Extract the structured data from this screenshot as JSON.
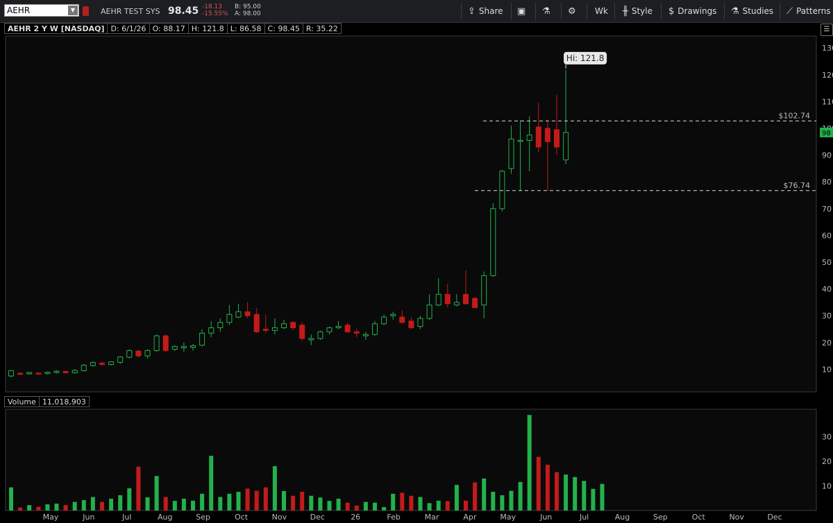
{
  "toolbar": {
    "symbol": "AEHR",
    "company": "AEHR TEST SYS",
    "last": "98.45",
    "net_change": "-18.13",
    "pct_change": "-15.55%",
    "bid": "B: 95.00",
    "ask": "A: 98.00",
    "share": "Share",
    "period": "Wk",
    "style": "Style",
    "drawings": "Drawings",
    "studies": "Studies",
    "patterns": "Patterns",
    "colors": {
      "up": "#22b14c",
      "down": "#c41a1a",
      "bg": "#0a0a0a"
    }
  },
  "info": {
    "title": "AEHR 2 Y W [NASDAQ]",
    "date": "D: 6/1/26",
    "open": "O: 88.17",
    "high": "H: 121.8",
    "low": "L: 86.58",
    "close": "C: 98.45",
    "range": "R: 35.22"
  },
  "volume_panel": {
    "label": "Volume",
    "value": "11,018,903"
  },
  "chart_data": {
    "type": "candlestick",
    "price_ticks": [
      "130",
      "120",
      "110",
      "100",
      "90",
      "80",
      "70",
      "60",
      "50",
      "40",
      "30",
      "20",
      "10"
    ],
    "volume_ticks": [
      "30",
      "20",
      "10"
    ],
    "x_labels": [
      "May",
      "Jun",
      "Jul",
      "Aug",
      "Sep",
      "Oct",
      "Nov",
      "Dec",
      "26",
      "Feb",
      "Mar",
      "Apr",
      "May",
      "Jun",
      "Jul",
      "Aug",
      "Sep",
      "Oct",
      "Nov",
      "Dec"
    ],
    "last_price_tag": "98",
    "hi_label": "Hi: 121.8",
    "lines": [
      {
        "label": "$102.74",
        "value": 102.74
      },
      {
        "label": "$76.74",
        "value": 76.74
      }
    ],
    "candles": [
      [
        7.5,
        9.5,
        7,
        9.8
      ],
      [
        8.5,
        8.2,
        8.0,
        9.0
      ],
      [
        8.3,
        8.8,
        8.0,
        9.0
      ],
      [
        8.6,
        8.3,
        8.0,
        8.9
      ],
      [
        8.4,
        8.9,
        8.1,
        9.2
      ],
      [
        8.8,
        9.3,
        8.4,
        9.6
      ],
      [
        9.2,
        8.7,
        8.3,
        9.4
      ],
      [
        8.7,
        9.6,
        8.4,
        10.0
      ],
      [
        9.5,
        11.5,
        9.2,
        12.0
      ],
      [
        11.4,
        12.5,
        11.0,
        13.0
      ],
      [
        12.3,
        11.8,
        11.3,
        12.8
      ],
      [
        11.8,
        12.8,
        11.5,
        13.0
      ],
      [
        12.6,
        14.6,
        12.0,
        15.0
      ],
      [
        14.5,
        17.0,
        14.0,
        17.5
      ],
      [
        16.8,
        15.0,
        14.3,
        17.2
      ],
      [
        15.0,
        17.0,
        14.0,
        17.5
      ],
      [
        17.0,
        22.5,
        16.5,
        23.0
      ],
      [
        22.5,
        17.0,
        16.5,
        23.0
      ],
      [
        17.5,
        18.5,
        16.8,
        19.0
      ],
      [
        18.0,
        18.5,
        16.5,
        20.0
      ],
      [
        18.2,
        18.8,
        17.0,
        19.5
      ],
      [
        19.0,
        23.5,
        18.5,
        25.0
      ],
      [
        23.5,
        25.5,
        22.0,
        28.0
      ],
      [
        25.5,
        27.5,
        24.0,
        29.0
      ],
      [
        27.5,
        30.5,
        26.5,
        34.0
      ],
      [
        29.5,
        31.5,
        29.0,
        34.5
      ],
      [
        31.5,
        30.0,
        29.0,
        35.0
      ],
      [
        30.5,
        24.0,
        23.5,
        33.0
      ],
      [
        25.0,
        24.5,
        23.5,
        30.5
      ],
      [
        24.5,
        25.5,
        23.0,
        29.0
      ],
      [
        25.5,
        27.0,
        25.0,
        28.5
      ],
      [
        27.5,
        25.5,
        24.5,
        28.0
      ],
      [
        26.5,
        21.5,
        20.5,
        27.5
      ],
      [
        21.0,
        21.5,
        19.0,
        23.0
      ],
      [
        21.5,
        24.0,
        21.0,
        24.5
      ],
      [
        24.0,
        25.5,
        23.0,
        26.0
      ],
      [
        25.5,
        26.0,
        25.0,
        28.0
      ],
      [
        26.5,
        24.0,
        23.5,
        27.5
      ],
      [
        24.0,
        23.5,
        22.0,
        25.0
      ],
      [
        22.5,
        23.0,
        21.0,
        24.0
      ],
      [
        23.0,
        27.0,
        22.5,
        28.0
      ],
      [
        27.0,
        29.5,
        26.5,
        30.5
      ],
      [
        30.0,
        30.5,
        28.5,
        31.5
      ],
      [
        29.5,
        27.5,
        27.0,
        32.0
      ],
      [
        28.0,
        25.5,
        25.0,
        29.5
      ],
      [
        26.0,
        29.0,
        25.0,
        30.0
      ],
      [
        29.0,
        34.0,
        28.5,
        38.0
      ],
      [
        34.0,
        38.0,
        33.5,
        44.0
      ],
      [
        38.0,
        34.5,
        33.0,
        42.0
      ],
      [
        34.0,
        35.0,
        33.5,
        38.0
      ],
      [
        38.0,
        34.5,
        34.0,
        47.0
      ],
      [
        36.5,
        33.0,
        33.0,
        37.0
      ],
      [
        34.0,
        45.0,
        29.0,
        46.5
      ],
      [
        45.0,
        70.0,
        44.5,
        72.0
      ],
      [
        70.0,
        84.0,
        69.0,
        84.5
      ],
      [
        85.0,
        96.0,
        83.0,
        101.0
      ],
      [
        95.5,
        95.5,
        76.7,
        103.0
      ],
      [
        95.5,
        97.5,
        84.0,
        104.5
      ],
      [
        100.5,
        93.0,
        91.0,
        109.5
      ],
      [
        100.0,
        95.0,
        76.7,
        102.5
      ],
      [
        99.5,
        93.0,
        90.0,
        112.5
      ],
      [
        88.2,
        98.45,
        86.58,
        121.8
      ]
    ],
    "volumes": [
      9.4,
      1.2,
      2.2,
      1.5,
      2.5,
      2.8,
      2.2,
      3.5,
      4.2,
      5.5,
      3.5,
      4.8,
      6.2,
      9.0,
      17.8,
      5.4,
      14.0,
      5.5,
      3.9,
      4.8,
      4.0,
      6.8,
      22.2,
      5.5,
      6.8,
      7.6,
      8.9,
      8.0,
      9.4,
      18.0,
      7.9,
      6.0,
      7.6,
      6.0,
      5.3,
      3.9,
      4.8,
      3.2,
      2.0,
      3.5,
      3.2,
      1.4,
      6.8,
      7.2,
      6.0,
      5.5,
      3.0,
      4.0,
      3.8,
      10.4,
      4.0,
      11.4,
      13.0,
      7.6,
      6.2,
      8.0,
      11.6,
      38.8,
      21.8,
      18.6,
      15.6,
      14.6,
      13.6,
      12.0,
      8.8,
      10.8
    ]
  }
}
